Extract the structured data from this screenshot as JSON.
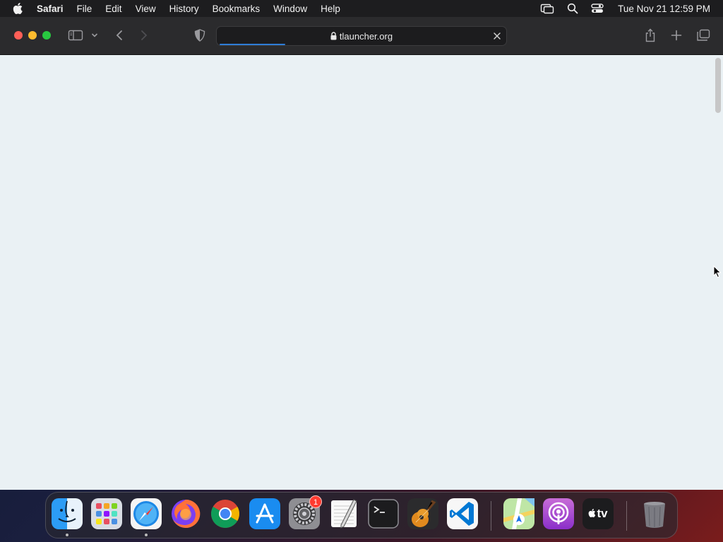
{
  "menubar": {
    "app_name": "Safari",
    "items": [
      "File",
      "Edit",
      "View",
      "History",
      "Bookmarks",
      "Window",
      "Help"
    ],
    "clock": "Tue Nov 21  12:59 PM"
  },
  "browser": {
    "address": "tlauncher.org",
    "load_progress": 0.23
  },
  "dock": {
    "apps": [
      "Finder",
      "Launchpad",
      "Safari",
      "Firefox",
      "Chrome",
      "App Store",
      "System Settings",
      "TextEdit",
      "Terminal",
      "GarageBand",
      "Visual Studio Code",
      "Maps",
      "Podcasts",
      "TV",
      "Trash"
    ],
    "running": [
      "Finder",
      "Safari"
    ],
    "badges": {
      "System Settings": "1"
    },
    "tv_label": "tv"
  }
}
